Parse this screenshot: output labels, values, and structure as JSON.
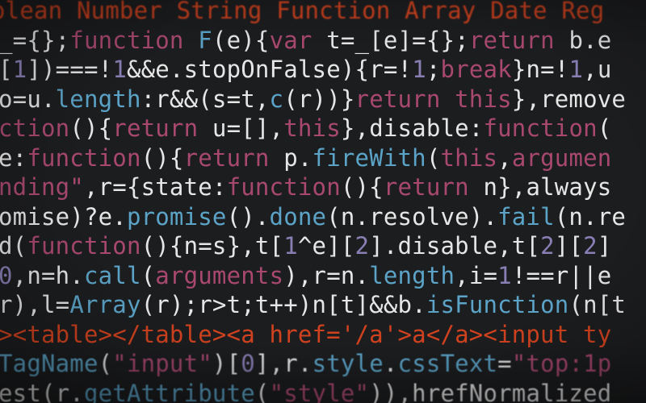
{
  "colors": {
    "plain": "#e6e6e6",
    "keyword": "#a8486f",
    "ident": "#5ba3c7",
    "number": "#8a7fb5",
    "string": "#a8486f",
    "tag": "#d0421f",
    "dim": "#9a9aa2"
  },
  "lines": [
    [
      {
        "t": "olean Number String Function Array Date Reg",
        "c": "tag"
      }
    ],
    [
      {
        "t": "_={};",
        "c": "plain"
      },
      {
        "t": "function ",
        "c": "keyword"
      },
      {
        "t": "F",
        "c": "ident"
      },
      {
        "t": "(e){",
        "c": "plain"
      },
      {
        "t": "var ",
        "c": "keyword"
      },
      {
        "t": "t=_[e]={};",
        "c": "plain"
      },
      {
        "t": "return ",
        "c": "keyword"
      },
      {
        "t": "b.e",
        "c": "plain"
      }
    ],
    [
      {
        "t": "[",
        "c": "plain"
      },
      {
        "t": "1",
        "c": "number"
      },
      {
        "t": "])===!",
        "c": "plain"
      },
      {
        "t": "1",
        "c": "number"
      },
      {
        "t": "&&e.stopOnFalse){r=!",
        "c": "plain"
      },
      {
        "t": "1",
        "c": "number"
      },
      {
        "t": ";",
        "c": "plain"
      },
      {
        "t": "break",
        "c": "keyword"
      },
      {
        "t": "}n=!",
        "c": "plain"
      },
      {
        "t": "1",
        "c": "number"
      },
      {
        "t": ",u",
        "c": "plain"
      }
    ],
    [
      {
        "t": "o=u.",
        "c": "plain"
      },
      {
        "t": "length",
        "c": "ident"
      },
      {
        "t": ":r&&(s=t,",
        "c": "plain"
      },
      {
        "t": "c",
        "c": "ident"
      },
      {
        "t": "(r))}",
        "c": "plain"
      },
      {
        "t": "return this",
        "c": "keyword"
      },
      {
        "t": "},remove",
        "c": "plain"
      }
    ],
    [
      {
        "t": "ction",
        "c": "keyword"
      },
      {
        "t": "(){",
        "c": "plain"
      },
      {
        "t": "return ",
        "c": "keyword"
      },
      {
        "t": "u=[],",
        "c": "plain"
      },
      {
        "t": "this",
        "c": "keyword"
      },
      {
        "t": "},disable:",
        "c": "plain"
      },
      {
        "t": "function",
        "c": "keyword"
      },
      {
        "t": "(",
        "c": "plain"
      }
    ],
    [
      {
        "t": "e:",
        "c": "plain"
      },
      {
        "t": "function",
        "c": "keyword"
      },
      {
        "t": "(){",
        "c": "plain"
      },
      {
        "t": "return ",
        "c": "keyword"
      },
      {
        "t": "p.",
        "c": "plain"
      },
      {
        "t": "fireWith",
        "c": "ident"
      },
      {
        "t": "(",
        "c": "plain"
      },
      {
        "t": "this",
        "c": "keyword"
      },
      {
        "t": ",",
        "c": "plain"
      },
      {
        "t": "argumen",
        "c": "keyword"
      }
    ],
    [
      {
        "t": "nding\"",
        "c": "string"
      },
      {
        "t": ",r={state:",
        "c": "plain"
      },
      {
        "t": "function",
        "c": "keyword"
      },
      {
        "t": "(){",
        "c": "plain"
      },
      {
        "t": "return ",
        "c": "keyword"
      },
      {
        "t": "n},always",
        "c": "plain"
      }
    ],
    [
      {
        "t": "omise)?e.",
        "c": "plain"
      },
      {
        "t": "promise",
        "c": "ident"
      },
      {
        "t": "().",
        "c": "plain"
      },
      {
        "t": "done",
        "c": "ident"
      },
      {
        "t": "(n.resolve).",
        "c": "plain"
      },
      {
        "t": "fail",
        "c": "ident"
      },
      {
        "t": "(n.re",
        "c": "plain"
      }
    ],
    [
      {
        "t": "d(",
        "c": "plain"
      },
      {
        "t": "function",
        "c": "keyword"
      },
      {
        "t": "(){n=s},t[",
        "c": "plain"
      },
      {
        "t": "1",
        "c": "number"
      },
      {
        "t": "^e][",
        "c": "plain"
      },
      {
        "t": "2",
        "c": "number"
      },
      {
        "t": "].disable,t[",
        "c": "plain"
      },
      {
        "t": "2",
        "c": "number"
      },
      {
        "t": "][",
        "c": "plain"
      },
      {
        "t": "2",
        "c": "number"
      },
      {
        "t": "]",
        "c": "plain"
      }
    ],
    [
      {
        "t": "0",
        "c": "number"
      },
      {
        "t": ",n=h.",
        "c": "plain"
      },
      {
        "t": "call",
        "c": "ident"
      },
      {
        "t": "(",
        "c": "plain"
      },
      {
        "t": "arguments",
        "c": "keyword"
      },
      {
        "t": "),r=n.",
        "c": "plain"
      },
      {
        "t": "length",
        "c": "ident"
      },
      {
        "t": ",i=",
        "c": "plain"
      },
      {
        "t": "1",
        "c": "number"
      },
      {
        "t": "!==r||e",
        "c": "plain"
      }
    ],
    [
      {
        "t": "r),l=",
        "c": "plain"
      },
      {
        "t": "Array",
        "c": "ident"
      },
      {
        "t": "(r);r>t;t++)n[t]&&b.",
        "c": "plain"
      },
      {
        "t": "isFunction",
        "c": "ident"
      },
      {
        "t": "(n[t",
        "c": "plain"
      }
    ],
    [
      {
        "t": "><table></table><a href='/a'>a</a><input ty",
        "c": "tag"
      }
    ],
    [
      {
        "t": "TagName",
        "c": "ident"
      },
      {
        "t": "(",
        "c": "plain"
      },
      {
        "t": "\"input\"",
        "c": "string"
      },
      {
        "t": ")[",
        "c": "plain"
      },
      {
        "t": "0",
        "c": "number"
      },
      {
        "t": "],r.",
        "c": "plain"
      },
      {
        "t": "style",
        "c": "ident"
      },
      {
        "t": ".",
        "c": "plain"
      },
      {
        "t": "cssText",
        "c": "ident"
      },
      {
        "t": "=",
        "c": "plain"
      },
      {
        "t": "\"top:1p",
        "c": "string"
      }
    ],
    [
      {
        "t": "est(r.",
        "c": "plain"
      },
      {
        "t": "getAttribute",
        "c": "ident"
      },
      {
        "t": "(",
        "c": "plain"
      },
      {
        "t": "\"style\"",
        "c": "string"
      },
      {
        "t": ")),hrefNormalized",
        "c": "plain"
      }
    ]
  ]
}
